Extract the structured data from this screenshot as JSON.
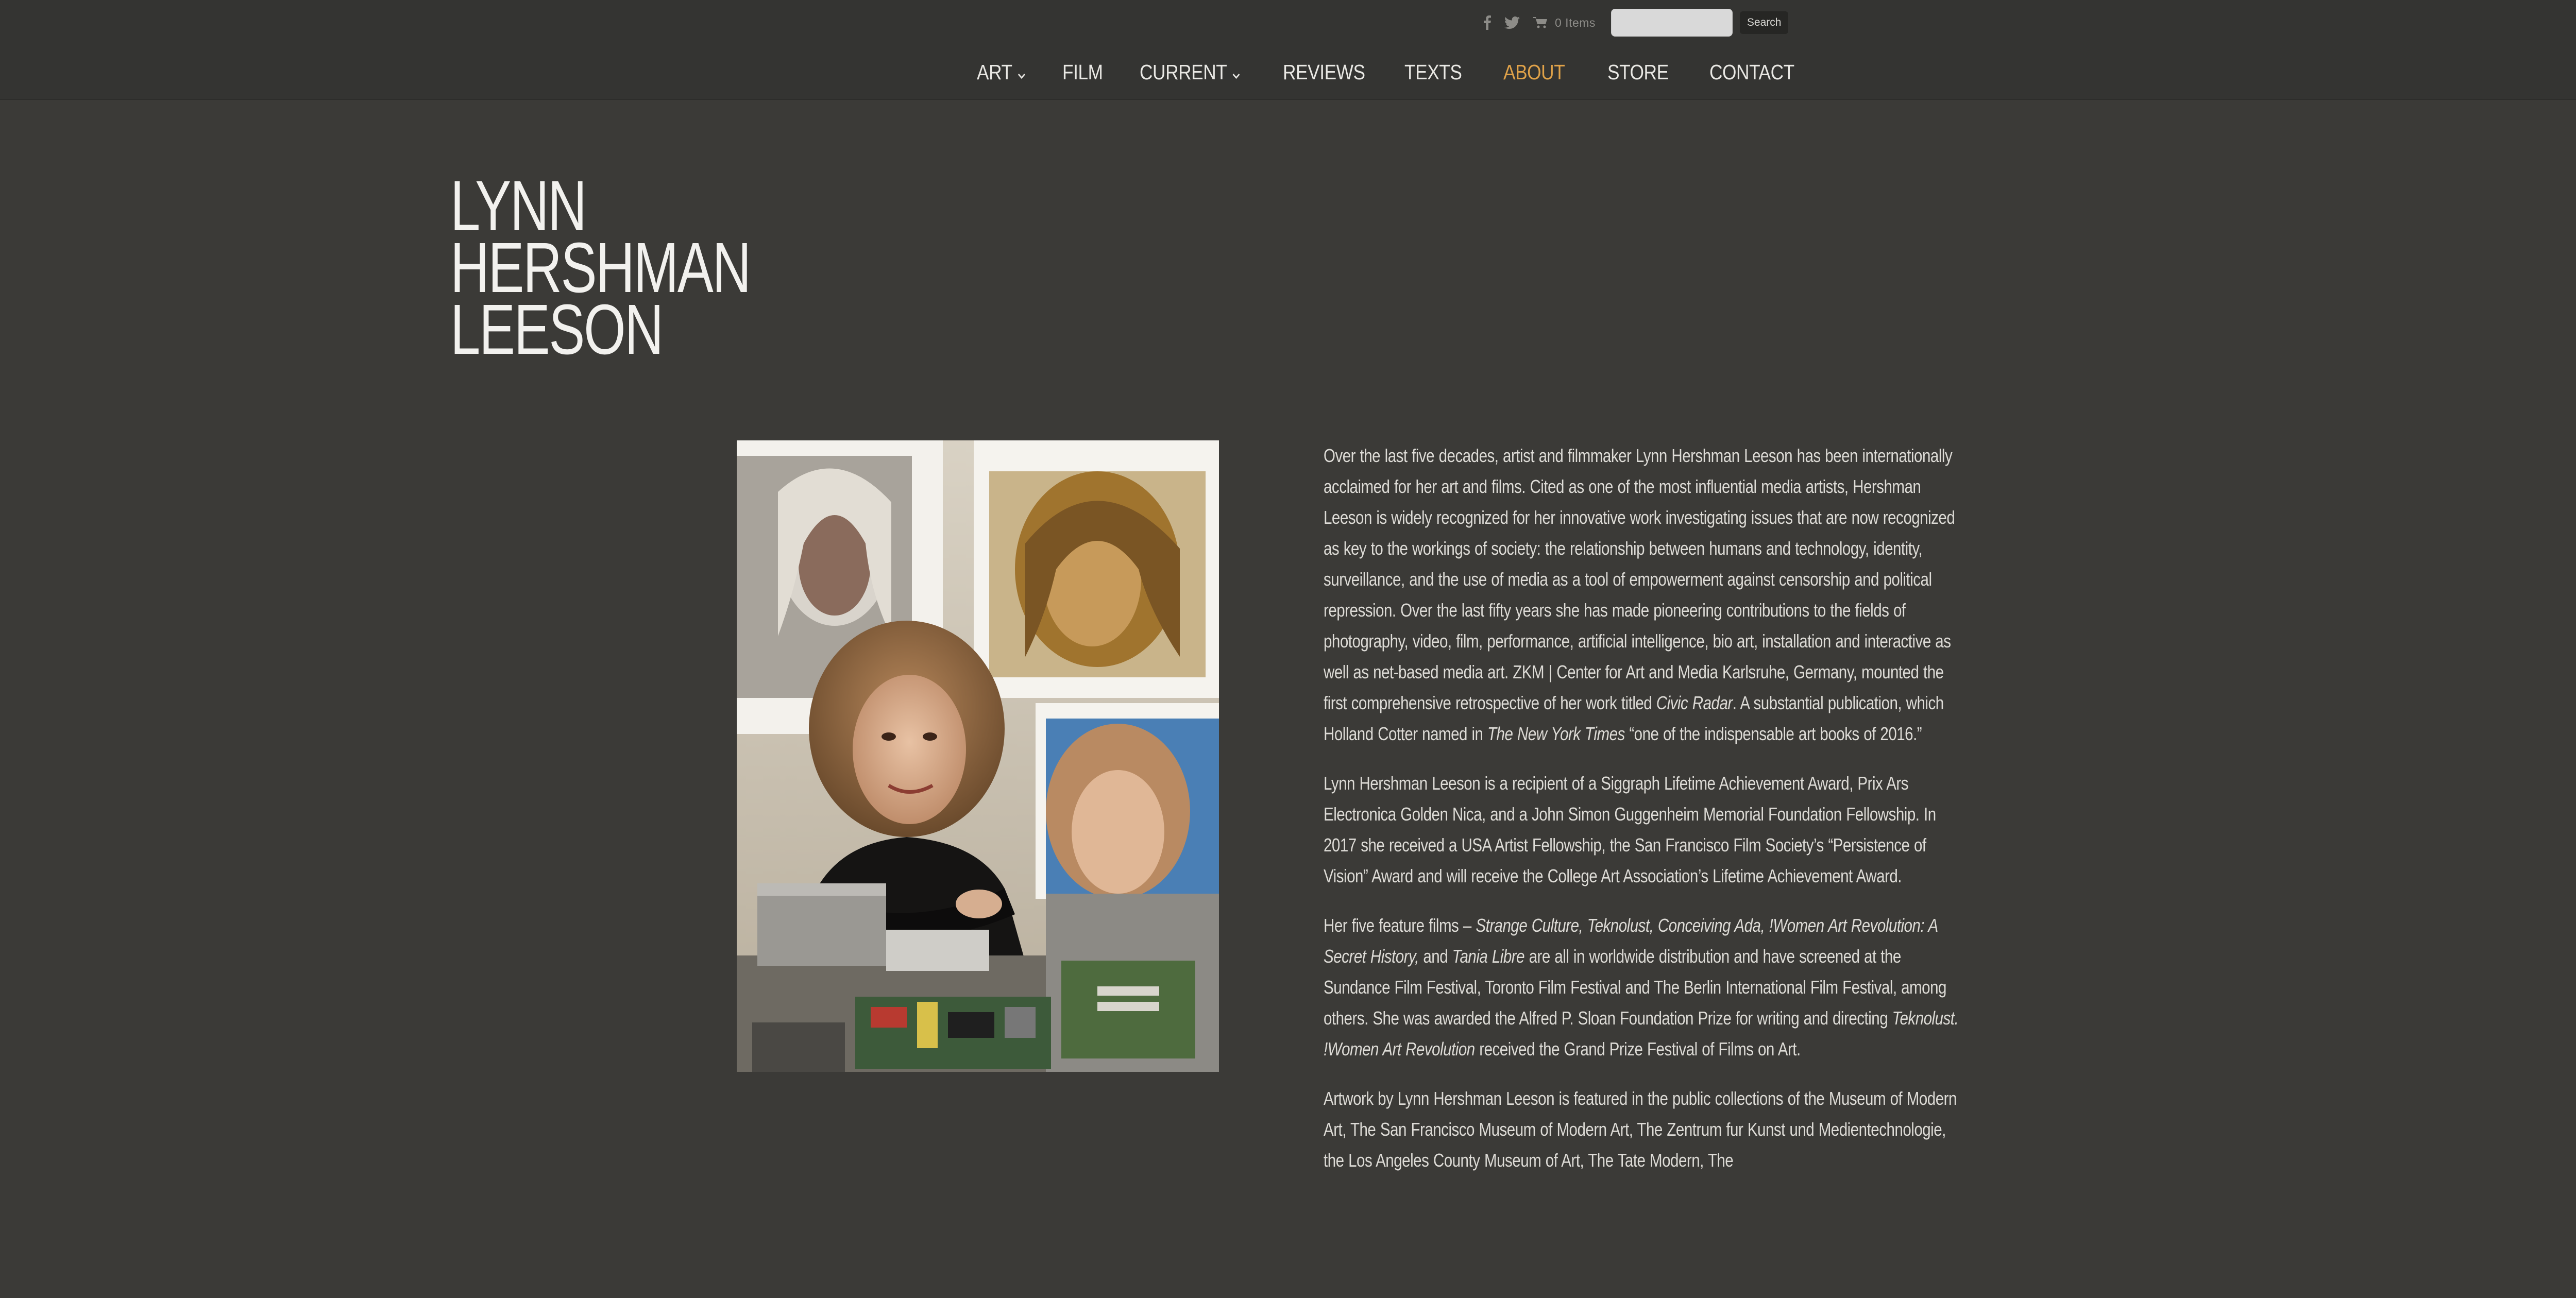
{
  "topbar": {
    "cart_label": "0 Items",
    "search_placeholder": "",
    "search_button": "Search"
  },
  "nav": {
    "items": [
      {
        "label": "ART",
        "dropdown": true
      },
      {
        "label": "FILM",
        "dropdown": false
      },
      {
        "label": "CURRENT",
        "dropdown": true
      },
      {
        "label": "REVIEWS",
        "dropdown": false
      },
      {
        "label": "TEXTS",
        "dropdown": false
      },
      {
        "label": "ABOUT",
        "dropdown": false,
        "active": true
      },
      {
        "label": "STORE",
        "dropdown": false
      },
      {
        "label": "CONTACT",
        "dropdown": false
      }
    ]
  },
  "title": {
    "line1": "LYNN",
    "line2": "HERSHMAN",
    "line3": "LEESON"
  },
  "bio": {
    "p1_a": "Over the last five decades, artist and filmmaker Lynn Hershman Leeson has been internationally acclaimed for her art and films. Cited as one of the most influential media artists, Hershman Leeson is widely recognized for her innovative work investigating issues that are now recognized as key to the workings of society: the relationship between humans and technology, identity, surveillance, and the use of media as a tool of empowerment against censorship and political repression. Over the last fifty years she has made pioneering contributions to the fields of photography, video, film, performance, artificial intelligence, bio art, installation and interactive as well as net-based media art. ZKM | Center for Art and Media Karlsruhe, Germany, mounted the first comprehensive retrospective of her work titled ",
    "p1_em1": "Civic Radar",
    "p1_b": ".  A substantial publication, which Holland Cotter named in ",
    "p1_em2": "The New York Times",
    "p1_c": " “one of the indispensable art books of 2016.”",
    "p2": "Lynn Hershman Leeson is a recipient of a Siggraph Lifetime Achievement Award, Prix Ars Electronica Golden Nica,  and a John Simon Guggenheim Memorial Foundation Fellowship. In 2017 she received a USA Artist Fellowship,  the San Francisco Film Society’s “Persistence of Vision” Award and will receive the College Art Association’s Lifetime Achievement Award.",
    "p3_a": "Her five feature films – ",
    "p3_em1": "Strange Culture, Teknolust, Conceiving Ada, !Women Art Revolution: A Secret History,",
    "p3_b": " and ",
    "p3_em2": "Tania Libre",
    "p3_c": " are all in worldwide distribution and have screened at the Sundance Film Festival, Toronto Film Festival and The Berlin International Film Festival, among others. She was awarded the Alfred P. Sloan Foundation Prize for writing and directing ",
    "p3_em3": "Teknolust. !Women Art Revolution",
    "p3_d": " received the Grand Prize Festival of Films on Art.",
    "p4": "Artwork by Lynn Hershman Leeson is featured in the public collections of the Museum of Modern Art, The San Francisco Museum of Modern Art, The Zentrum fur Kunst und Medientechnologie, the Los Angeles County Museum of Art, The Tate Modern, The"
  },
  "colors": {
    "background": "#3b3a37",
    "header": "#343432",
    "active_nav": "#e0a249"
  }
}
